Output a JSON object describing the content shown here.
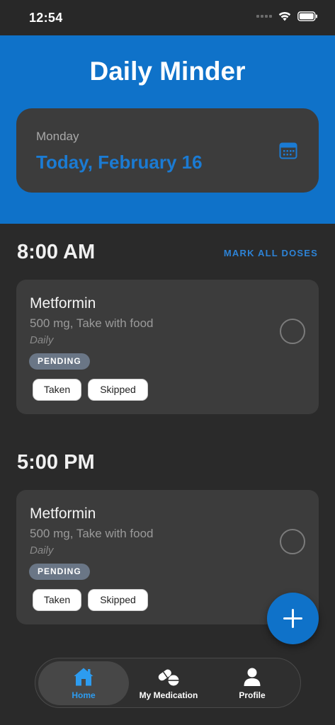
{
  "status_bar": {
    "time": "12:54"
  },
  "header": {
    "title": "Daily Minder"
  },
  "date_card": {
    "day": "Monday",
    "full_date": "Today, February 16"
  },
  "mark_all_label": "MARK ALL DOSES",
  "schedule": [
    {
      "time": "8:00 AM",
      "medication": {
        "name": "Metformin",
        "detail": "500 mg, Take with food",
        "frequency": "Daily",
        "status": "PENDING",
        "taken_label": "Taken",
        "skipped_label": "Skipped"
      }
    },
    {
      "time": "5:00 PM",
      "medication": {
        "name": "Metformin",
        "detail": "500 mg, Take with food",
        "frequency": "Daily",
        "status": "PENDING",
        "taken_label": "Taken",
        "skipped_label": "Skipped"
      }
    }
  ],
  "tabs": [
    {
      "label": "Home",
      "icon": "home-icon",
      "active": true
    },
    {
      "label": "My Medication",
      "icon": "pills-icon",
      "active": false
    },
    {
      "label": "Profile",
      "icon": "person-icon",
      "active": false
    }
  ],
  "colors": {
    "accent": "#0f72c9",
    "background": "#2a2a2a",
    "card": "#3c3c3c",
    "badge": "#6a7686",
    "active_tab_label": "#2d9cf0"
  }
}
